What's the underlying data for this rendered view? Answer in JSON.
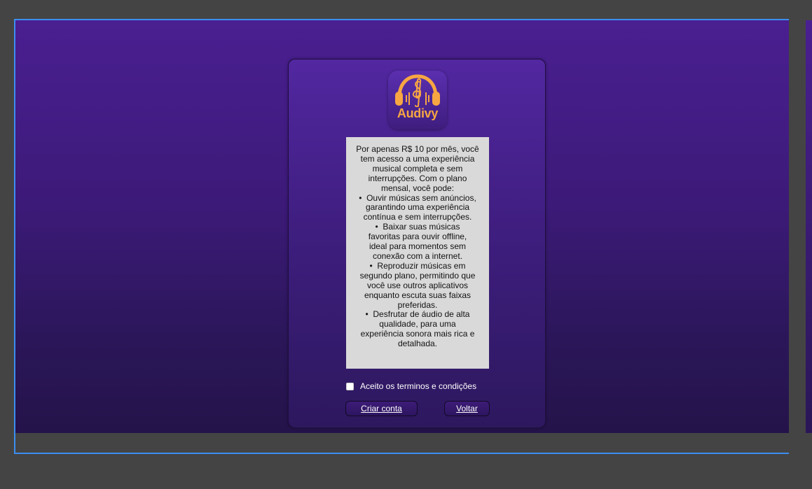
{
  "logo": {
    "text": "Audivy",
    "icon": "headphones-treble-clef-icon",
    "color": "#f7a642"
  },
  "terms": {
    "intro": "Por apenas R$ 10 por mês, você tem acesso a uma experiência musical completa e sem interrupções. Com o plano mensal, você pode:",
    "items": [
      "Ouvir músicas sem anúncios, garantindo uma experiência contínua e sem interrupções.",
      "Baixar suas músicas favoritas para ouvir offline, ideal para momentos sem conexão com a internet.",
      "Reproduzir músicas em segundo plano, permitindo que você use outros aplicativos enquanto escuta suas faixas preferidas.",
      "Desfrutar de áudio de alta qualidade, para uma experiência sonora mais rica e detalhada."
    ]
  },
  "accept": {
    "label": "Aceito os terminos e condições",
    "checked": false
  },
  "buttons": {
    "create": "Criar conta",
    "back": "Voltar"
  },
  "colors": {
    "background_top": "#4a1f91",
    "background_bottom": "#24134a",
    "accent": "#f7a642",
    "selection_outline": "#3d8ef0"
  }
}
